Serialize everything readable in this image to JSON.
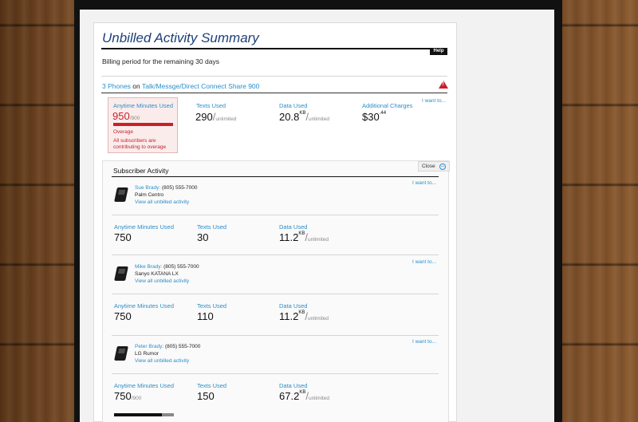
{
  "header": {
    "title": "Unbilled Activity Summary",
    "help_label": "Help",
    "billing_period": "Billing period for the remaining 30 days"
  },
  "plan": {
    "phones_link": "3 Phones",
    "on_text": "on",
    "plan_link": "Talk/Messge/Direct Connect Share 900",
    "alert_icon": "warning-triangle-icon"
  },
  "summary": {
    "minutes": {
      "label": "Anytime Minutes Used",
      "value": "950",
      "limit": "900",
      "status": "Overage",
      "note": "All subscribers are contributing to overage",
      "usage_fraction": 1.0
    },
    "texts": {
      "label": "Texts Used",
      "value": "290",
      "limit": "unlimited"
    },
    "data": {
      "label": "Data Used",
      "value": "20.8",
      "unit": "KB",
      "limit": "unlimited"
    },
    "charges": {
      "label": "Additional Charges",
      "value": "$30",
      "cents": ".44"
    },
    "i_want_label": "I want to..."
  },
  "subscriber_activity": {
    "title": "Subscriber Activity",
    "close_label": "Close",
    "subscribers": [
      {
        "name": "Sue Brady:",
        "phone": "(805) 555-7000",
        "device": "Palm Centro",
        "view_link": "View all unbilled activity",
        "i_want_label": "I want to...",
        "minutes_label": "Anytime Minutes Used",
        "minutes": "750",
        "minutes_limit": "",
        "texts_label": "Texts Used",
        "texts": "30",
        "data_label": "Data Used",
        "data": "11.2",
        "data_unit": "KB",
        "data_limit": "unlimited"
      },
      {
        "name": "Mike Brady:",
        "phone": "(805) 555-7000",
        "device": "Sanyo KATANA LX",
        "view_link": "View all unbilled activity",
        "i_want_label": "I want to...",
        "minutes_label": "Anytime Minutes Used",
        "minutes": "750",
        "minutes_limit": "",
        "texts_label": "Texts Used",
        "texts": "110",
        "data_label": "Data Used",
        "data": "11.2",
        "data_unit": "KB",
        "data_limit": "unlimited"
      },
      {
        "name": "Peter Brady:",
        "phone": "(805) 555-7000",
        "device": "LG Rumor",
        "view_link": "View all unbilled activity",
        "i_want_label": "I want to...",
        "minutes_label": "Anytime Minutes Used",
        "minutes": "750",
        "minutes_limit": "900",
        "minutes_fraction": 0.83,
        "texts_label": "Texts Used",
        "texts": "150",
        "data_label": "Data Used",
        "data": "67.2",
        "data_unit": "KB",
        "data_limit": "unlimited"
      }
    ]
  },
  "colors": {
    "accent": "#2a8fc9",
    "alert": "#c8202a",
    "title": "#1c3f7a"
  }
}
